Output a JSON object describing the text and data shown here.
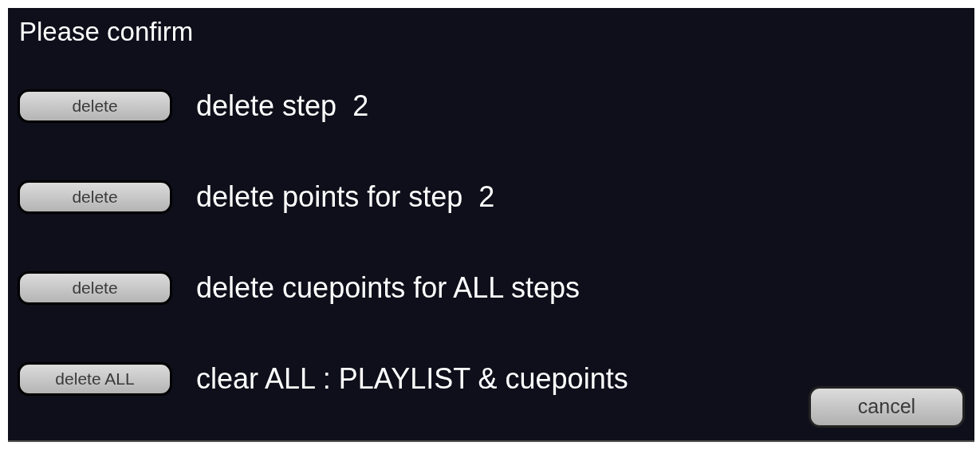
{
  "dialog": {
    "title": "Please confirm",
    "rows": [
      {
        "button": "delete",
        "label": "delete step  2"
      },
      {
        "button": "delete",
        "label": "delete points for step  2"
      },
      {
        "button": "delete",
        "label": "delete cuepoints for ALL steps"
      },
      {
        "button": "delete ALL",
        "label": "clear ALL : PLAYLIST & cuepoints"
      }
    ],
    "cancel": "cancel"
  }
}
